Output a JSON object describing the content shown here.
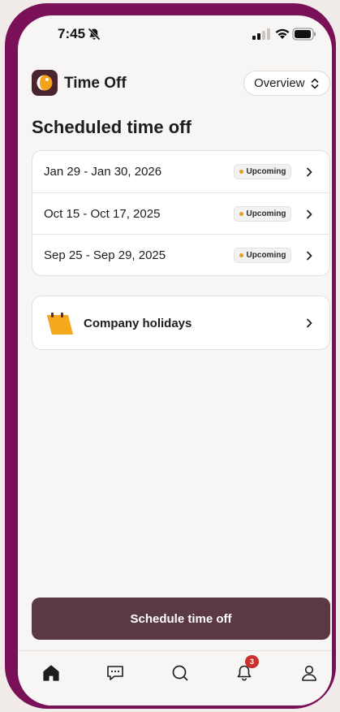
{
  "status_bar": {
    "time": "7:45"
  },
  "header": {
    "title": "Time Off",
    "view_selector": "Overview"
  },
  "section": {
    "title": "Scheduled time off"
  },
  "time_off": [
    {
      "dates": "Jan 29 - Jan 30, 2026",
      "status": "Upcoming"
    },
    {
      "dates": "Oct 15 - Oct 17, 2025",
      "status": "Upcoming"
    },
    {
      "dates": "Sep 25 - Sep 29, 2025",
      "status": "Upcoming"
    }
  ],
  "holidays": {
    "label": "Company holidays"
  },
  "actions": {
    "schedule": "Schedule time off"
  },
  "tabbar": {
    "notifications_count": "3"
  },
  "colors": {
    "brand": "#7a1057",
    "button": "#5a3942",
    "status_dot": "#e2a21a",
    "badge": "#c8322d"
  }
}
